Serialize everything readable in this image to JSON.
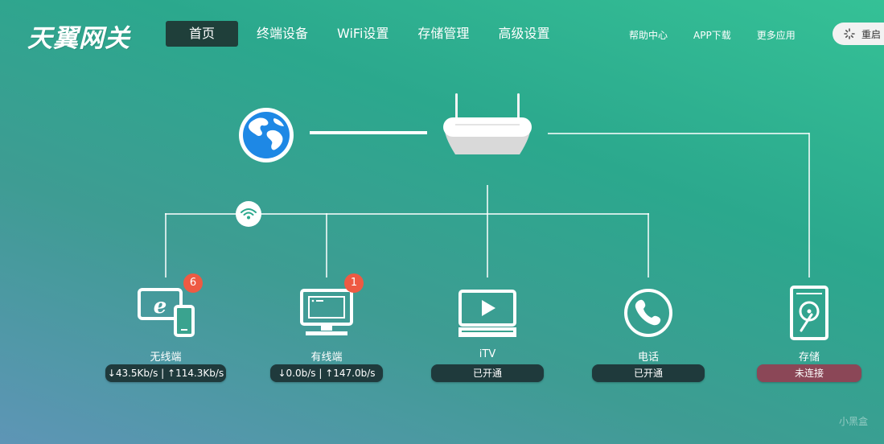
{
  "brand": {
    "logo": "天翼网关"
  },
  "nav": {
    "items": [
      "首页",
      "终端设备",
      "WiFi设置",
      "存储管理",
      "高级设置"
    ]
  },
  "links": [
    "帮助中心",
    "APP下载",
    "更多应用"
  ],
  "restart": {
    "label": "重启"
  },
  "devices": {
    "wireless": {
      "label": "无线端",
      "status": "↓43.5Kb/s | ↑114.3Kb/s",
      "badge": "6"
    },
    "wired": {
      "label": "有线端",
      "status": "↓0.0b/s | ↑147.0b/s",
      "badge": "1"
    },
    "itv": {
      "label": "iTV",
      "status": "已开通"
    },
    "phone": {
      "label": "电话",
      "status": "已开通"
    },
    "storage": {
      "label": "存储",
      "status": "未连接"
    }
  },
  "watermark": "小黑盒",
  "colors": {
    "active_nav": "#1f3f3a",
    "status_pill": "#1f3a3c",
    "status_disconnected": "#8b4757",
    "badge": "#ee5a43",
    "globe": "#1e88e5"
  }
}
